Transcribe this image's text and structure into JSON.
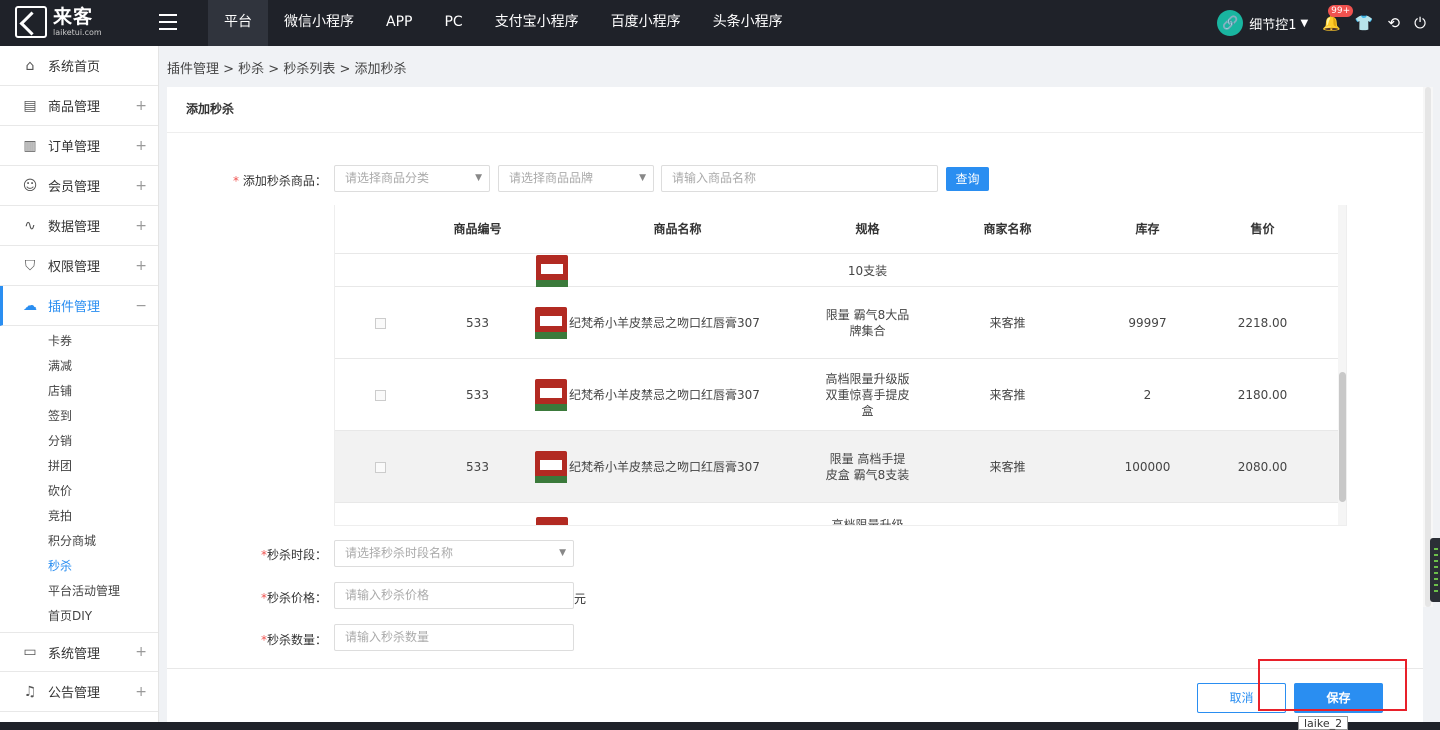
{
  "brand": {
    "name": "来客",
    "domain": "laiketui.com"
  },
  "top_nav": [
    "平台",
    "微信小程序",
    "APP",
    "PC",
    "支付宝小程序",
    "百度小程序",
    "头条小程序"
  ],
  "top_nav_active": 0,
  "user": {
    "name": "细节控1",
    "notification_count": "99",
    "notification_plus": "+"
  },
  "sidebar": {
    "items": [
      {
        "label": "系统首页",
        "icon": "home-icon"
      },
      {
        "label": "商品管理",
        "icon": "shop-icon",
        "toggle": "+"
      },
      {
        "label": "订单管理",
        "icon": "order-icon",
        "toggle": "+"
      },
      {
        "label": "会员管理",
        "icon": "user-icon",
        "toggle": "+"
      },
      {
        "label": "数据管理",
        "icon": "chart-icon",
        "toggle": "+"
      },
      {
        "label": "权限管理",
        "icon": "shield-icon",
        "toggle": "+"
      },
      {
        "label": "插件管理",
        "icon": "plugin-icon",
        "toggle": "−"
      }
    ],
    "sub_items": [
      "卡券",
      "满减",
      "店铺",
      "签到",
      "分销",
      "拼团",
      "砍价",
      "竞拍",
      "积分商城",
      "秒杀",
      "平台活动管理",
      "首页DIY"
    ],
    "active_sub": 9,
    "bottom_items": [
      {
        "label": "系统管理",
        "icon": "monitor-icon",
        "toggle": "+"
      },
      {
        "label": "公告管理",
        "icon": "bell-icon",
        "toggle": "+"
      }
    ]
  },
  "breadcrumb": "插件管理 > 秒杀 > 秒杀列表 > 添加秒杀",
  "panel_title": "添加秒杀",
  "form": {
    "required_mark": "*",
    "goods_label": "添加秒杀商品：",
    "category_placeholder": "请选择商品分类",
    "brand_placeholder": "请选择商品品牌",
    "name_placeholder": "请输入商品名称",
    "query_button": "查询",
    "time_label": "秒杀时段：",
    "time_placeholder": "请选择秒杀时段名称",
    "price_label": "秒杀价格：",
    "price_placeholder": "请输入秒杀价格",
    "price_unit": "元",
    "qty_label": "秒杀数量：",
    "qty_placeholder": "请输入秒杀数量"
  },
  "table": {
    "columns": [
      "商品编号",
      "商品名称",
      "规格",
      "商家名称",
      "库存",
      "售价"
    ],
    "partial_top": {
      "spec": "10支装"
    },
    "rows": [
      {
        "id": "533",
        "name": "纪梵希小羊皮禁忌之吻口红唇膏307",
        "spec": "限量 霸气8大品牌集合",
        "merchant": "来客推",
        "stock": "99997",
        "price": "2218.00"
      },
      {
        "id": "533",
        "name": "纪梵希小羊皮禁忌之吻口红唇膏307",
        "spec": "高档限量升级版双重惊喜手提皮盒",
        "merchant": "来客推",
        "stock": "2",
        "price": "2180.00"
      },
      {
        "id": "533",
        "name": "纪梵希小羊皮禁忌之吻口红唇膏307",
        "spec": "限量 高档手提皮盒 霸气8支装",
        "merchant": "来客推",
        "stock": "100000",
        "price": "2080.00"
      }
    ],
    "partial_bottom": {
      "spec": "高档限量升级"
    }
  },
  "footer": {
    "cancel": "取消",
    "save": "保存"
  },
  "tooltip": "laike_2"
}
